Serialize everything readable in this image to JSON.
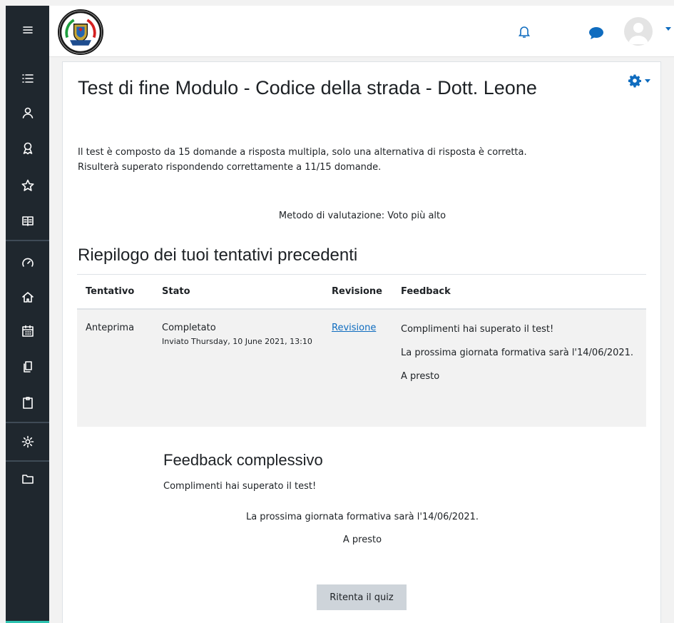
{
  "colors": {
    "sidebar": "#1f272e",
    "accent": "#2ec3b0",
    "brand": "#0f6cbf",
    "button": "#ced4da"
  },
  "sidebar": {
    "icons": [
      "menu-icon",
      "list-icon",
      "user-icon",
      "badge-icon",
      "star-icon",
      "book-icon",
      "dashboard-icon",
      "home-icon",
      "calendar-icon",
      "files-icon",
      "clipboard-icon",
      "cog-icon",
      "folder-icon"
    ]
  },
  "quiz": {
    "title": "Test di fine Modulo - Codice della strada - Dott. Leone",
    "intro_line1": "Il test è composto da 15 domande a risposta multipla, solo una alternativa di risposta è corretta.",
    "intro_line2": "Risulterà superato rispondendo correttamente a 11/15 domande.",
    "grading_method": "Metodo di valutazione: Voto più alto"
  },
  "summary": {
    "heading": "Riepilogo dei tuoi tentativi precedenti",
    "columns": [
      "Tentativo",
      "Stato",
      "Revisione",
      "Feedback"
    ],
    "rows": [
      {
        "attempt": "Anteprima",
        "state": "Completato",
        "submitted": "Inviato Thursday, 10 June 2021, 13:10",
        "review": "Revisione",
        "feedback": [
          "Complimenti hai superato il test!",
          "La prossima giornata formativa sarà l'14/06/2021.",
          "A presto"
        ]
      }
    ]
  },
  "overall": {
    "heading": "Feedback complessivo",
    "line1": "Complimenti hai superato il test!",
    "line2": "La prossima giornata formativa sarà l'14/06/2021.",
    "line3": "A presto"
  },
  "retry_label": "Ritenta il quiz"
}
